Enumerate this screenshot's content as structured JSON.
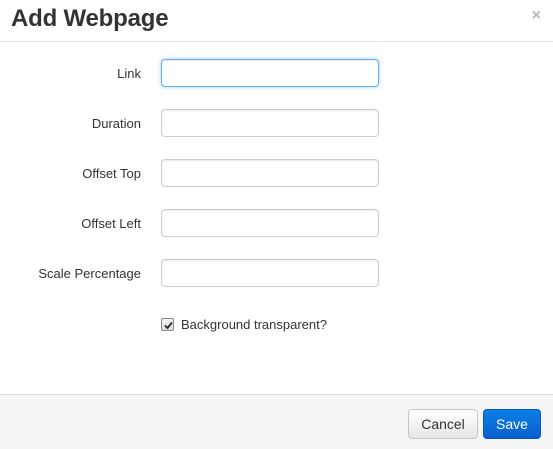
{
  "dialog": {
    "title": "Add Webpage",
    "close_glyph": "×",
    "close_icon": "close-icon"
  },
  "form": {
    "fields": [
      {
        "label": "Link",
        "value": "",
        "placeholder": "",
        "focused": true
      },
      {
        "label": "Duration",
        "value": "",
        "placeholder": ""
      },
      {
        "label": "Offset Top",
        "value": "",
        "placeholder": ""
      },
      {
        "label": "Offset Left",
        "value": "",
        "placeholder": ""
      },
      {
        "label": "Scale Percentage",
        "value": "",
        "placeholder": ""
      }
    ],
    "checkbox": {
      "label": "Background transparent?",
      "checked": true
    }
  },
  "footer": {
    "cancel_label": "Cancel",
    "save_label": "Save"
  },
  "colors": {
    "primary": "#0a6fd8",
    "focus_ring": "#66afe9",
    "footer_bg": "#f5f5f5"
  }
}
